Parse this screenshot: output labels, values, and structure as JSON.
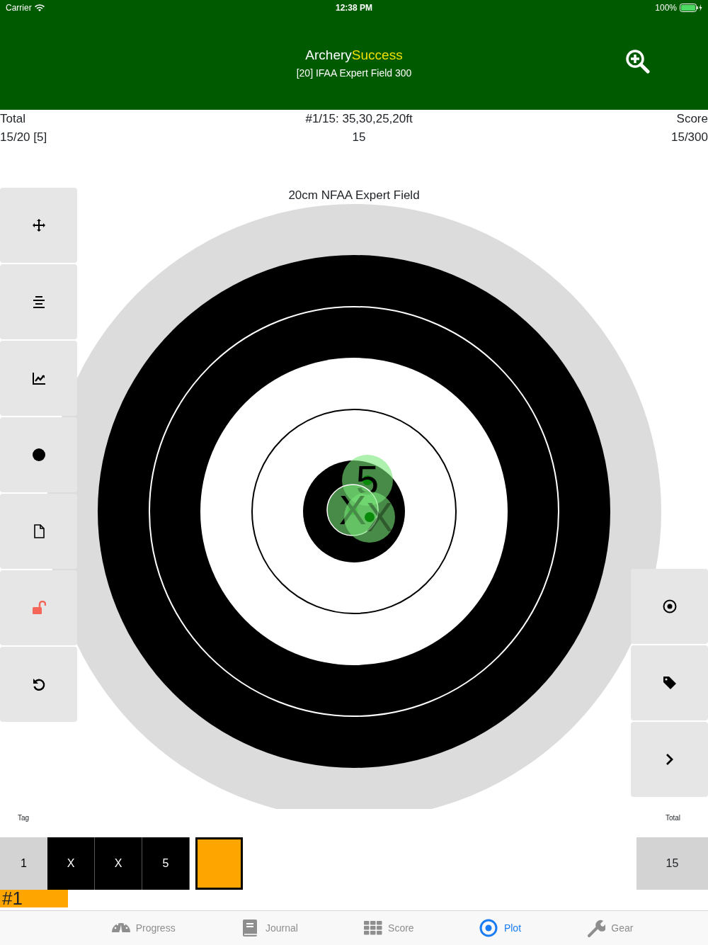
{
  "status_bar": {
    "carrier": "Carrier",
    "time": "12:38 PM",
    "battery": "100%"
  },
  "header": {
    "title_first": "Archery",
    "title_second": "Success",
    "subtitle": "[20] IFAA Expert Field 300"
  },
  "info": {
    "left_label": "Total",
    "left_value": "15/20 [5]",
    "center_label": "#1/15: 35,30,25,20ft",
    "center_value": "15",
    "right_label": "Score",
    "right_value": "15/300"
  },
  "target": {
    "title": "20cm NFAA Expert Field",
    "arrows": [
      {
        "label": "5"
      },
      {
        "label": "X"
      },
      {
        "label": "X"
      }
    ]
  },
  "end": {
    "tag_label": "Tag",
    "total_label": "Total",
    "tag": "1",
    "scores": [
      "X",
      "X",
      "5"
    ],
    "total": "15",
    "end_badge": "#1"
  },
  "tabs": [
    {
      "label": "Progress",
      "selected": false
    },
    {
      "label": "Journal",
      "selected": false
    },
    {
      "label": "Score",
      "selected": false
    },
    {
      "label": "Plot",
      "selected": true
    },
    {
      "label": "Gear",
      "selected": false
    }
  ]
}
